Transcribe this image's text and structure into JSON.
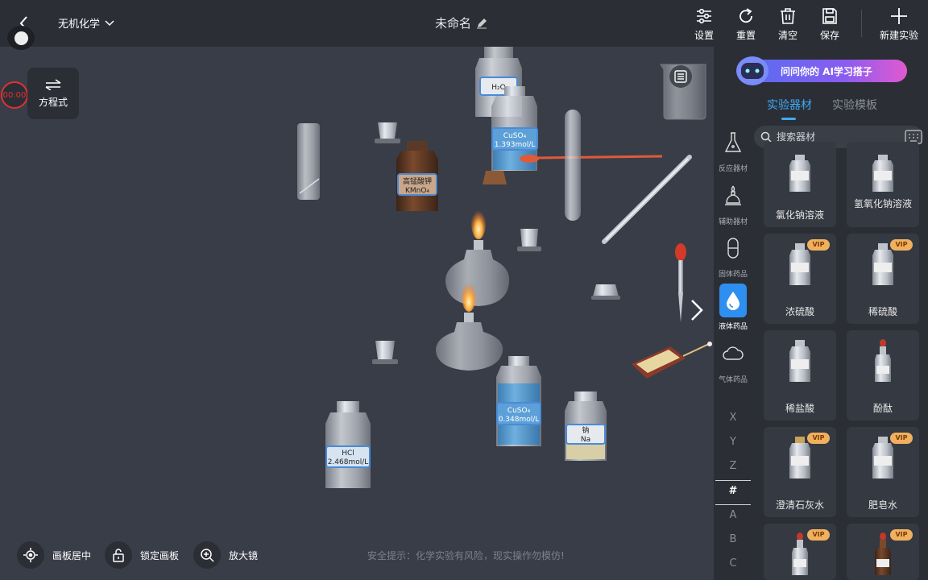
{
  "header": {
    "subject": "无机化学",
    "title": "未命名",
    "actions": [
      {
        "label": "设置",
        "icon": "settings-sliders-icon"
      },
      {
        "label": "重置",
        "icon": "refresh-icon"
      },
      {
        "label": "清空",
        "icon": "trash-icon"
      },
      {
        "label": "保存",
        "icon": "save-icon"
      }
    ],
    "new_experiment": "新建实验"
  },
  "timer": "00:00",
  "equation_button": "方程式",
  "bottom_tools": {
    "center": "画板居中",
    "lock": "锁定画板",
    "magnifier": "放大镜"
  },
  "safety_tip": "安全提示：化学实验有风险，现实操作勿模仿!",
  "canvas_labels": {
    "h2o": "H₂O",
    "cuso4_top_name": "CuSO₄",
    "cuso4_top_conc": "1.393mol/L",
    "kmno4_name": "高锰酸钾",
    "kmno4_formula": "KMnO₄",
    "cuso4_bottom_name": "CuSO₄",
    "cuso4_bottom_conc": "0.348mol/L",
    "sodium_name": "钠",
    "sodium_formula": "Na",
    "hcl_name": "HCl",
    "hcl_conc": "2.468mol/L"
  },
  "ai_banner": "问问你的 AI学习搭子",
  "panel": {
    "tabs": [
      {
        "label": "实验器材",
        "active": true
      },
      {
        "label": "实验模板",
        "active": false
      }
    ],
    "search_placeholder": "搜索器材",
    "categories": [
      {
        "label": "反应器材",
        "icon": "flask-icon",
        "active": false
      },
      {
        "label": "辅助器材",
        "icon": "alcohol-lamp-icon",
        "active": false
      },
      {
        "label": "固体药品",
        "icon": "capsule-icon",
        "active": false
      },
      {
        "label": "液体药品",
        "icon": "droplet-icon",
        "active": true
      },
      {
        "label": "气体药品",
        "icon": "cloud-icon",
        "active": false
      }
    ],
    "alphabet": [
      "X",
      "Y",
      "Z",
      "#",
      "A",
      "B",
      "C"
    ],
    "alphabet_selected": "#",
    "items": [
      {
        "label": "氯化钠溶液",
        "vip": false
      },
      {
        "label": "氢氧化钠溶液",
        "vip": false
      },
      {
        "label": "浓硫酸",
        "vip": true
      },
      {
        "label": "稀硫酸",
        "vip": true
      },
      {
        "label": "稀盐酸",
        "vip": false
      },
      {
        "label": "酚酞",
        "vip": false
      },
      {
        "label": "澄清石灰水",
        "vip": true
      },
      {
        "label": "肥皂水",
        "vip": true
      },
      {
        "label": "",
        "vip": true
      },
      {
        "label": "",
        "vip": true
      }
    ],
    "vip_label": "VIP"
  },
  "colors": {
    "accent": "#3fa9f5",
    "background": "#393d47",
    "panel": "#2b2e35",
    "timer_red": "#dd3333",
    "vip": "#f0b060"
  }
}
